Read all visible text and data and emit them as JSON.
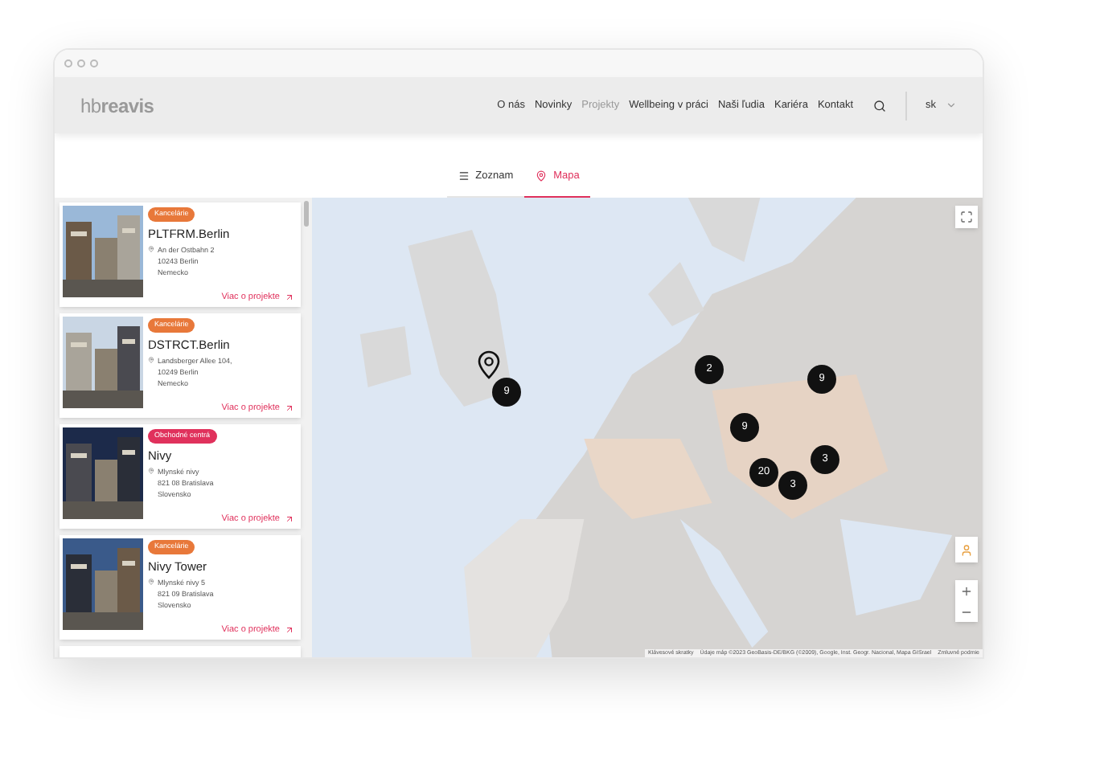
{
  "brand": {
    "light": "hb",
    "bold": "reavis"
  },
  "nav": [
    {
      "label": "O nás",
      "selected": false
    },
    {
      "label": "Novinky",
      "selected": false
    },
    {
      "label": "Projekty",
      "selected": true
    },
    {
      "label": "Wellbeing v práci",
      "selected": false
    },
    {
      "label": "Naši ľudia",
      "selected": false
    },
    {
      "label": "Kariéra",
      "selected": false
    },
    {
      "label": "Kontakt",
      "selected": false
    }
  ],
  "language": "sk",
  "view_tabs": [
    {
      "label": "Zoznam",
      "kind": "list",
      "selected": false
    },
    {
      "label": "Mapa",
      "kind": "map",
      "selected": true
    }
  ],
  "projects": [
    {
      "tag": "Kancelárie",
      "color": "#e8783a",
      "name": "PLTFRM.Berlin",
      "address": [
        "An der Ostbahn 2",
        "10243 Berlin",
        "Nemecko"
      ],
      "link": "Viac o projekte"
    },
    {
      "tag": "Kancelárie",
      "color": "#e8783a",
      "name": "DSTRCT.Berlin",
      "address": [
        "Landsberger Allee 104,",
        "10249 Berlin",
        "Nemecko"
      ],
      "link": "Viac o projekte"
    },
    {
      "tag": "Obchodné centrá",
      "color": "#e0315c",
      "name": "Nivy",
      "address": [
        "Mlynské nivy",
        "821 08 Bratislava",
        "Slovensko"
      ],
      "link": "Viac o projekte"
    },
    {
      "tag": "Kancelárie",
      "color": "#e8783a",
      "name": "Nivy Tower",
      "address": [
        "Mlynské nivy 5",
        "821 09 Bratislava",
        "Slovensko"
      ],
      "link": "Viac o projekte"
    }
  ],
  "map": {
    "clusters": [
      "9",
      "2",
      "9",
      "9",
      "3",
      "20",
      "3"
    ],
    "attribution": [
      "Klávesové skratky",
      "Údaje máp ©2023 GeoBasis-DE/BKG (©2009), Google, Inst. Geogr. Nacional, Mapa GISrael",
      "Zmluvné podmie"
    ]
  }
}
